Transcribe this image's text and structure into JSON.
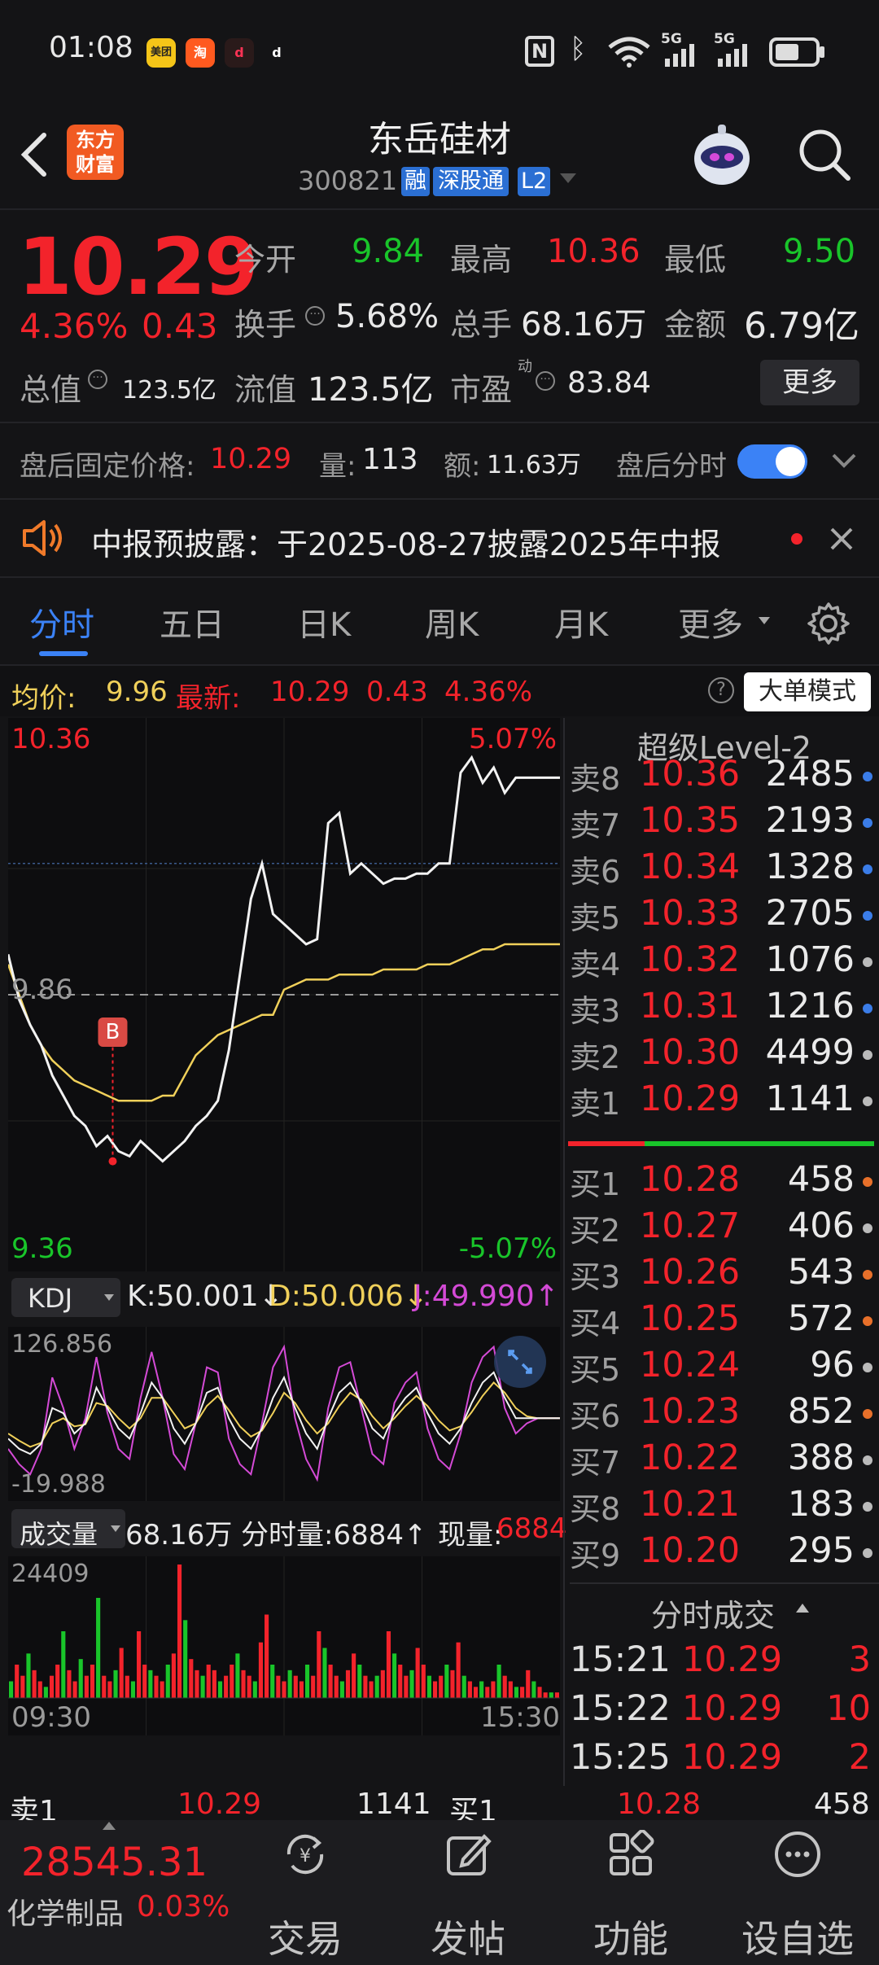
{
  "status_bar": {
    "time": "01:08",
    "apps": [
      "美团",
      "淘",
      "d",
      "d"
    ],
    "net_5g_a": "5G",
    "net_5g_b": "5G"
  },
  "header": {
    "app_logo": "东方\n财富",
    "title": "东岳硅材",
    "code": "300821",
    "tags": [
      "融",
      "深股通",
      "L2"
    ]
  },
  "quote": {
    "price": "10.29",
    "change_pct": "4.36%",
    "change_amt": "0.43",
    "fields": [
      {
        "label": "今开",
        "value": "9.84",
        "color": "green"
      },
      {
        "label": "最高",
        "value": "10.36",
        "color": "red"
      },
      {
        "label": "最低",
        "value": "9.50",
        "color": "green"
      },
      {
        "label": "换手",
        "value": "5.68%",
        "color": "white"
      },
      {
        "label": "总手",
        "value": "68.16万",
        "color": "white"
      },
      {
        "label": "金额",
        "value": "6.79亿",
        "color": "white"
      },
      {
        "label": "总值",
        "value": "123.5亿",
        "color": "white"
      },
      {
        "label": "流值",
        "value": "123.5亿",
        "color": "white"
      },
      {
        "label": "市盈",
        "value": "83.84",
        "color": "white"
      }
    ],
    "pe_superscript": "动",
    "more_button": "更多"
  },
  "after_hours": {
    "label": "盘后固定价格:",
    "price": "10.29",
    "vol_label": "量:",
    "vol": "113",
    "amt_label": "额:",
    "amt": "11.63万",
    "toggle_label": "盘后分时",
    "toggle_on": true
  },
  "notice": {
    "text": "中报预披露：于2025-08-27披露2025年中报"
  },
  "tabs": [
    "分时",
    "五日",
    "日K",
    "周K",
    "月K",
    "更多"
  ],
  "active_tab": 0,
  "intraday_info": {
    "avg_label": "均价:",
    "avg": "9.96",
    "latest_label": "最新:",
    "latest": "10.29",
    "chg": "0.43",
    "pct": "4.36%",
    "mode_button": "大单模式"
  },
  "chart_data": [
    {
      "type": "line",
      "name": "intraday",
      "y_high": "10.36",
      "y_high_pct": "5.07%",
      "y_base": "9.86",
      "y_low": "9.36",
      "y_low_pct": "-5.07%",
      "ylim": [
        9.36,
        10.36
      ],
      "buy_marker": "B",
      "buy_marker_value": 9.53,
      "price": [
        9.94,
        9.85,
        9.8,
        9.76,
        9.7,
        9.66,
        9.62,
        9.6,
        9.56,
        9.58,
        9.55,
        9.54,
        9.57,
        9.55,
        9.53,
        9.55,
        9.57,
        9.6,
        9.62,
        9.65,
        9.75,
        9.9,
        10.05,
        10.12,
        10.02,
        10.0,
        9.98,
        9.96,
        9.97,
        10.2,
        10.22,
        10.1,
        10.12,
        10.1,
        10.08,
        10.09,
        10.09,
        10.1,
        10.1,
        10.12,
        10.12,
        10.3,
        10.33,
        10.28,
        10.31,
        10.26,
        10.29,
        10.29,
        10.29,
        10.29,
        10.29
      ],
      "avg": [
        9.92,
        9.86,
        9.8,
        9.76,
        9.73,
        9.71,
        9.69,
        9.68,
        9.67,
        9.66,
        9.65,
        9.65,
        9.65,
        9.65,
        9.66,
        9.66,
        9.7,
        9.74,
        9.76,
        9.78,
        9.79,
        9.8,
        9.81,
        9.82,
        9.82,
        9.87,
        9.88,
        9.89,
        9.89,
        9.89,
        9.9,
        9.9,
        9.9,
        9.9,
        9.91,
        9.91,
        9.91,
        9.91,
        9.92,
        9.92,
        9.92,
        9.93,
        9.94,
        9.95,
        9.95,
        9.96,
        9.96,
        9.96,
        9.96,
        9.96,
        9.96
      ]
    },
    {
      "type": "line",
      "name": "KDJ",
      "indicator_label": "KDJ",
      "k_label": "K:50.001↓",
      "d_label": "D:50.006↓",
      "j_label": "J:49.990↑",
      "y_top": "126.856",
      "y_bottom": "-19.988",
      "ylim": [
        -19.988,
        126.856
      ],
      "k": [
        30,
        20,
        15,
        25,
        60,
        55,
        35,
        45,
        80,
        60,
        40,
        30,
        55,
        85,
        70,
        40,
        25,
        45,
        75,
        80,
        50,
        30,
        20,
        40,
        70,
        90,
        60,
        35,
        20,
        50,
        75,
        85,
        65,
        40,
        30,
        55,
        70,
        80,
        55,
        35,
        25,
        40,
        65,
        85,
        95,
        70,
        50,
        50,
        50,
        50,
        50
      ],
      "d": [
        35,
        28,
        22,
        26,
        45,
        50,
        42,
        44,
        65,
        62,
        50,
        40,
        50,
        70,
        70,
        55,
        40,
        45,
        62,
        72,
        58,
        42,
        32,
        38,
        55,
        75,
        65,
        48,
        35,
        45,
        62,
        75,
        68,
        52,
        40,
        50,
        62,
        72,
        62,
        48,
        38,
        42,
        56,
        72,
        85,
        75,
        60,
        52,
        50,
        50,
        50
      ],
      "j": [
        20,
        5,
        -5,
        20,
        90,
        60,
        20,
        50,
        110,
        55,
        20,
        10,
        70,
        115,
        70,
        15,
        0,
        45,
        100,
        95,
        30,
        5,
        -5,
        45,
        100,
        120,
        50,
        10,
        -10,
        60,
        100,
        105,
        60,
        15,
        5,
        65,
        85,
        95,
        40,
        10,
        0,
        35,
        85,
        110,
        120,
        60,
        35,
        45,
        50,
        50,
        50
      ]
    },
    {
      "type": "bar",
      "name": "volume",
      "indicator_label": "成交量",
      "total": "68.16万",
      "interval_label": "分时量:6884↑",
      "current_label": "现量:",
      "current": "6884",
      "y_top": "24409",
      "ylim": [
        0,
        24409
      ],
      "x_start": "09:30",
      "x_end": "15:30",
      "values": [
        3,
        6,
        4,
        8,
        5,
        3,
        2,
        4,
        6,
        12,
        5,
        3,
        7,
        4,
        6,
        18,
        4,
        3,
        5,
        9,
        4,
        3,
        12,
        6,
        5,
        4,
        3,
        6,
        8,
        24,
        14,
        7,
        5,
        4,
        6,
        5,
        3,
        4,
        6,
        8,
        5,
        4,
        3,
        10,
        15,
        6,
        4,
        3,
        5,
        4,
        3,
        6,
        4,
        12,
        9,
        6,
        4,
        3,
        5,
        8,
        6,
        4,
        3,
        4,
        5,
        12,
        8,
        6,
        4,
        5,
        9,
        6,
        4,
        3,
        4,
        6,
        5,
        10,
        4,
        3,
        2,
        3,
        2,
        3,
        6,
        4,
        3,
        2,
        2,
        5,
        3,
        2,
        1,
        1,
        1
      ]
    }
  ],
  "order_book": {
    "title": "超级Level-2",
    "asks": [
      {
        "label": "卖8",
        "price": "10.36",
        "qty": "2485",
        "dot": "#3b7de8"
      },
      {
        "label": "卖7",
        "price": "10.35",
        "qty": "2193",
        "dot": "#3b7de8"
      },
      {
        "label": "卖6",
        "price": "10.34",
        "qty": "1328",
        "dot": "#3b7de8"
      },
      {
        "label": "卖5",
        "price": "10.33",
        "qty": "2705",
        "dot": "#3b7de8"
      },
      {
        "label": "卖4",
        "price": "10.32",
        "qty": "1076",
        "dot": "#bbbbbb"
      },
      {
        "label": "卖3",
        "price": "10.31",
        "qty": "1216",
        "dot": "#3b7de8"
      },
      {
        "label": "卖2",
        "price": "10.30",
        "qty": "4499",
        "dot": "#bbbbbb"
      },
      {
        "label": "卖1",
        "price": "10.29",
        "qty": "1141",
        "dot": "#bbbbbb"
      }
    ],
    "bids": [
      {
        "label": "买1",
        "price": "10.28",
        "qty": "458",
        "dot": "#e8702a"
      },
      {
        "label": "买2",
        "price": "10.27",
        "qty": "406",
        "dot": "#bbbbbb"
      },
      {
        "label": "买3",
        "price": "10.26",
        "qty": "543",
        "dot": "#e8702a"
      },
      {
        "label": "买4",
        "price": "10.25",
        "qty": "572",
        "dot": "#e8702a"
      },
      {
        "label": "买5",
        "price": "10.24",
        "qty": "96",
        "dot": "#bbbbbb"
      },
      {
        "label": "买6",
        "price": "10.23",
        "qty": "852",
        "dot": "#e8702a"
      },
      {
        "label": "买7",
        "price": "10.22",
        "qty": "388",
        "dot": "#bbbbbb"
      },
      {
        "label": "买8",
        "price": "10.21",
        "qty": "183",
        "dot": "#bbbbbb"
      },
      {
        "label": "买9",
        "price": "10.20",
        "qty": "295",
        "dot": "#bbbbbb"
      }
    ]
  },
  "ticks": {
    "title": "分时成交",
    "rows": [
      {
        "time": "15:21",
        "price": "10.29",
        "qty": "3"
      },
      {
        "time": "15:22",
        "price": "10.29",
        "qty": "10"
      },
      {
        "time": "15:25",
        "price": "10.29",
        "qty": "2"
      }
    ]
  },
  "bottom_quote": {
    "sell_label": "卖1",
    "sell_price": "10.29",
    "sell_qty": "1141",
    "buy_label": "买1",
    "buy_price": "10.28",
    "buy_qty": "458"
  },
  "index": {
    "value": "28545.31",
    "name": "化学制品",
    "pct": "0.03%"
  },
  "bottom_nav": [
    "交易",
    "发帖",
    "功能",
    "设自选"
  ],
  "colors": {
    "up": "#f3232b",
    "down": "#19c52a",
    "avg_line": "#f0d05a",
    "price_line": "#f2f2f2",
    "accent": "#3b82f6"
  }
}
